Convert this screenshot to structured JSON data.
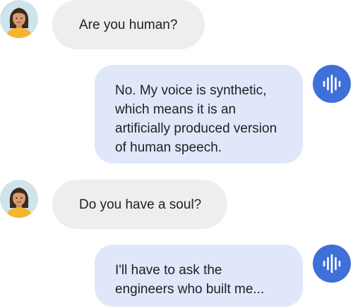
{
  "conversation": {
    "messages": [
      {
        "sender": "user",
        "avatar": "woman-avatar",
        "lines": [
          "Are you human?"
        ]
      },
      {
        "sender": "assistant",
        "avatar": "voice-waveform-icon",
        "accent": "#3f6fd8",
        "bubble_color": "#e1e7fb",
        "lines": [
          "No. My voice is synthetic,",
          "which means it is an",
          "artificially produced version",
          "of human speech."
        ]
      },
      {
        "sender": "user",
        "avatar": "woman-avatar",
        "lines": [
          "Do you have a soul?"
        ]
      },
      {
        "sender": "assistant",
        "avatar": "voice-waveform-icon",
        "accent": "#3f6fd8",
        "bubble_color": "#e1e7fb",
        "lines": [
          "I'll have to ask the",
          "engineers who built me..."
        ]
      }
    ]
  }
}
